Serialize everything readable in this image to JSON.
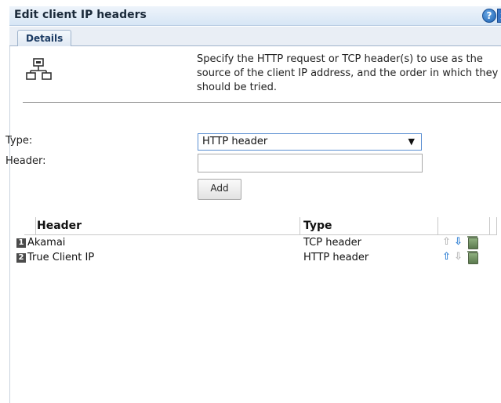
{
  "dialog": {
    "title": "Edit client IP headers",
    "help_icon": "?",
    "close_icon": "x"
  },
  "tabs": [
    {
      "label": "Details"
    }
  ],
  "details": {
    "icon": "network-icon",
    "description": "Specify the HTTP request or TCP header(s) to use as the source of the client IP address, and the order in which they should be tried."
  },
  "form": {
    "type_label": "Type:",
    "type_value": "HTTP header",
    "header_label": "Header:",
    "header_value": "",
    "add_label": "Add"
  },
  "table": {
    "columns": [
      "Header",
      "Type"
    ],
    "rows": [
      {
        "num": "1",
        "header": "Akamai",
        "type": "TCP header",
        "up_enabled": false,
        "down_enabled": true
      },
      {
        "num": "2",
        "header": "True Client IP",
        "type": "HTTP header",
        "up_enabled": true,
        "down_enabled": false
      }
    ]
  },
  "colors": {
    "accent": "#2f7fd3",
    "title_bg": "#d7e6f5"
  }
}
